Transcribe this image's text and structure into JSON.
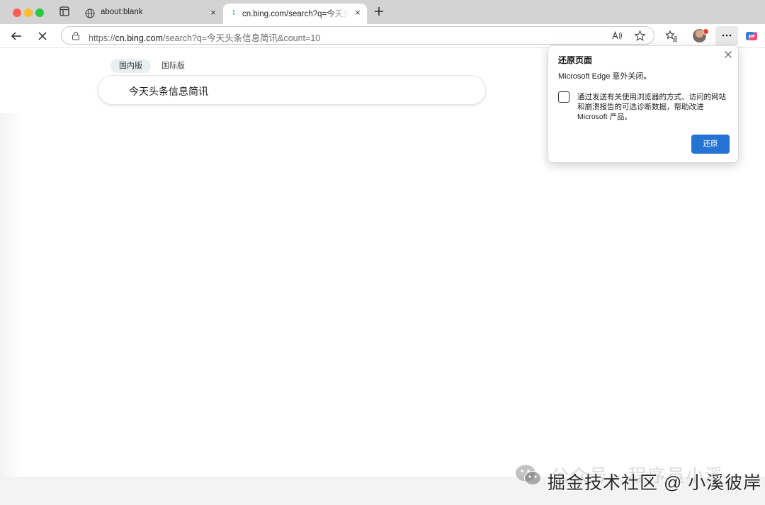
{
  "browser": {
    "tabs": [
      {
        "title": "about:blank",
        "close": "×",
        "favicon": "globe-icon"
      },
      {
        "title": "cn.bing.com/search?q=今天头条",
        "close": "×",
        "favicon": "loading-icon"
      }
    ],
    "address": {
      "scheme": "https://",
      "host": "cn.bing.com",
      "path": "/search?q=今天头条信息简讯&count=10"
    },
    "accent": "#2574d4"
  },
  "page": {
    "scope_tabs": [
      "国内版",
      "国际版"
    ],
    "search_query": "今天头条信息简讯"
  },
  "popup": {
    "title": "还原页面",
    "message": "Microsoft Edge 意外关闭。",
    "checkbox_label": "通过发送有关使用浏览器的方式、访问的网站和崩溃报告的可选诊断数据，帮助改进 Microsoft 产品。",
    "checked": false,
    "button": "还原"
  },
  "watermark": {
    "line1": "公众号 · 程序员小溪",
    "line2": "掘金技术社区 @ 小溪彼岸"
  }
}
